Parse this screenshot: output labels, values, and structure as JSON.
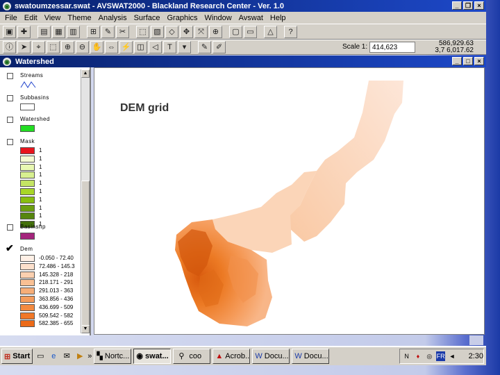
{
  "app": {
    "title": "swatoumzessar.swat - AVSWAT2000 - Blackland Research Center - Ver. 1.0",
    "menu": [
      "File",
      "Edit",
      "View",
      "Theme",
      "Analysis",
      "Surface",
      "Graphics",
      "Window",
      "Avswat",
      "Help"
    ]
  },
  "toolbar": {
    "scale_label": "Scale 1:",
    "scale_value": "414,623",
    "coord_x": "586,929.63",
    "coord_y": "3,7 6,017.62"
  },
  "view": {
    "title": "Watershed",
    "map_label": "DEM grid"
  },
  "legend": {
    "themes": [
      {
        "name": "Streams",
        "checked": false
      },
      {
        "name": "Subbasins",
        "checked": false
      },
      {
        "name": "Watershed",
        "checked": false
      },
      {
        "name": "Mask",
        "checked": false
      },
      {
        "name": "Basinshp",
        "checked": false
      },
      {
        "name": "Dem",
        "checked": true
      }
    ],
    "mask_classes": [
      {
        "label": "1",
        "color": "#e8141c"
      },
      {
        "label": "1",
        "color": "#f4fbd2"
      },
      {
        "label": "1",
        "color": "#e8f8b2"
      },
      {
        "label": "1",
        "color": "#d8f090"
      },
      {
        "label": "1",
        "color": "#c4e464"
      },
      {
        "label": "1",
        "color": "#a8d628"
      },
      {
        "label": "1",
        "color": "#88be10"
      },
      {
        "label": "1",
        "color": "#6c9e10"
      },
      {
        "label": "1",
        "color": "#56860e"
      },
      {
        "label": "1",
        "color": "#44700c"
      }
    ],
    "dem_classes": [
      {
        "label": "-0.050 - 72.40",
        "color": "#fff0e6"
      },
      {
        "label": "72.486 - 145.3",
        "color": "#fde0cc"
      },
      {
        "label": "145.328 - 218",
        "color": "#fbd0b0"
      },
      {
        "label": "218.171 - 291",
        "color": "#f9c094"
      },
      {
        "label": "291.013 - 363",
        "color": "#f7ae78"
      },
      {
        "label": "363.856 - 436",
        "color": "#f59c5c"
      },
      {
        "label": "436.699 - 509",
        "color": "#f38a40"
      },
      {
        "label": "509.542 - 582",
        "color": "#f17828"
      },
      {
        "label": "582.385 - 655",
        "color": "#ec6a18"
      }
    ],
    "watershed_color": "#22dd22",
    "basinshp_color": "#a4247c"
  },
  "taskbar": {
    "start": "Start",
    "chevron": "»",
    "tasks": [
      "Nortc...",
      "swat...",
      "coo",
      "Acrob...",
      "Docu...",
      "Docu..."
    ],
    "lang": "FR",
    "clock": "2:30"
  }
}
